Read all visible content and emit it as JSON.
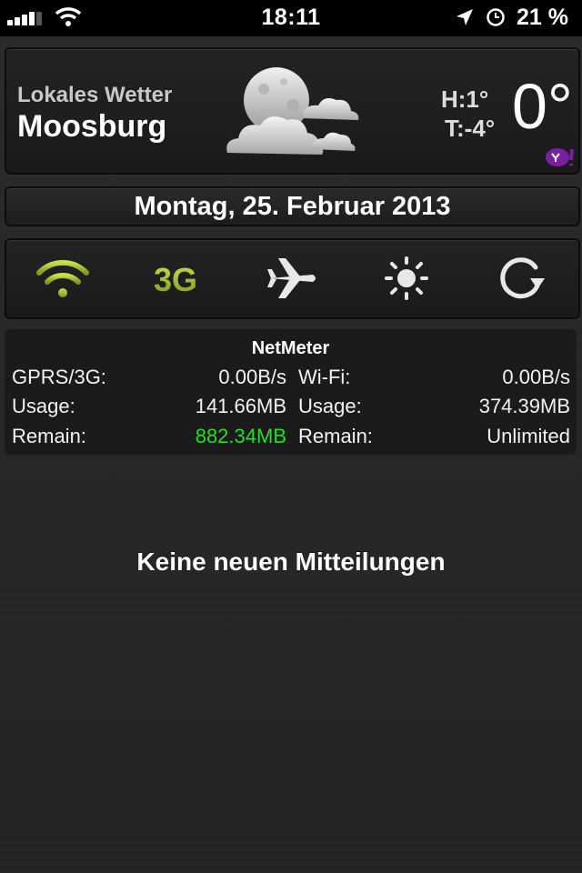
{
  "status_bar": {
    "time": "18:11",
    "battery": "21 %",
    "signal_icon": "signal-bars-icon",
    "wifi_icon": "wifi-icon",
    "location_icon": "location-arrow-icon",
    "alarm_icon": "alarm-clock-icon"
  },
  "weather": {
    "subtitle": "Lokales Wetter",
    "city": "Moosburg",
    "high": "H:1°",
    "low": "T:-4°",
    "current": "0°",
    "condition_icon": "moon-clouds-icon",
    "provider_icon": "yahoo-logo"
  },
  "date": "Montag, 25. Februar 2013",
  "toggles": [
    {
      "name": "wifi-toggle",
      "icon": "wifi-icon",
      "state": "on"
    },
    {
      "name": "3g-toggle",
      "label": "3G",
      "state": "on"
    },
    {
      "name": "airplane-toggle",
      "icon": "airplane-icon",
      "state": "off"
    },
    {
      "name": "brightness-toggle",
      "icon": "brightness-icon",
      "state": "off"
    },
    {
      "name": "rotation-lock-toggle",
      "icon": "rotate-icon",
      "state": "off"
    }
  ],
  "netmeter": {
    "title": "NetMeter",
    "mobile": {
      "speed_label": "GPRS/3G:",
      "speed": "0.00B/s",
      "usage_label": "Usage:",
      "usage": "141.66MB",
      "remain_label": "Remain:",
      "remain": "882.34MB"
    },
    "wifi": {
      "speed_label": "Wi-Fi:",
      "speed": "0.00B/s",
      "usage_label": "Usage:",
      "usage": "374.39MB",
      "remain_label": "Remain:",
      "remain": "Unlimited"
    }
  },
  "empty_message": "Keine neuen Mitteilungen",
  "colors": {
    "toggle_active": "#a4c43a",
    "remain_highlight": "#2adc2a"
  }
}
